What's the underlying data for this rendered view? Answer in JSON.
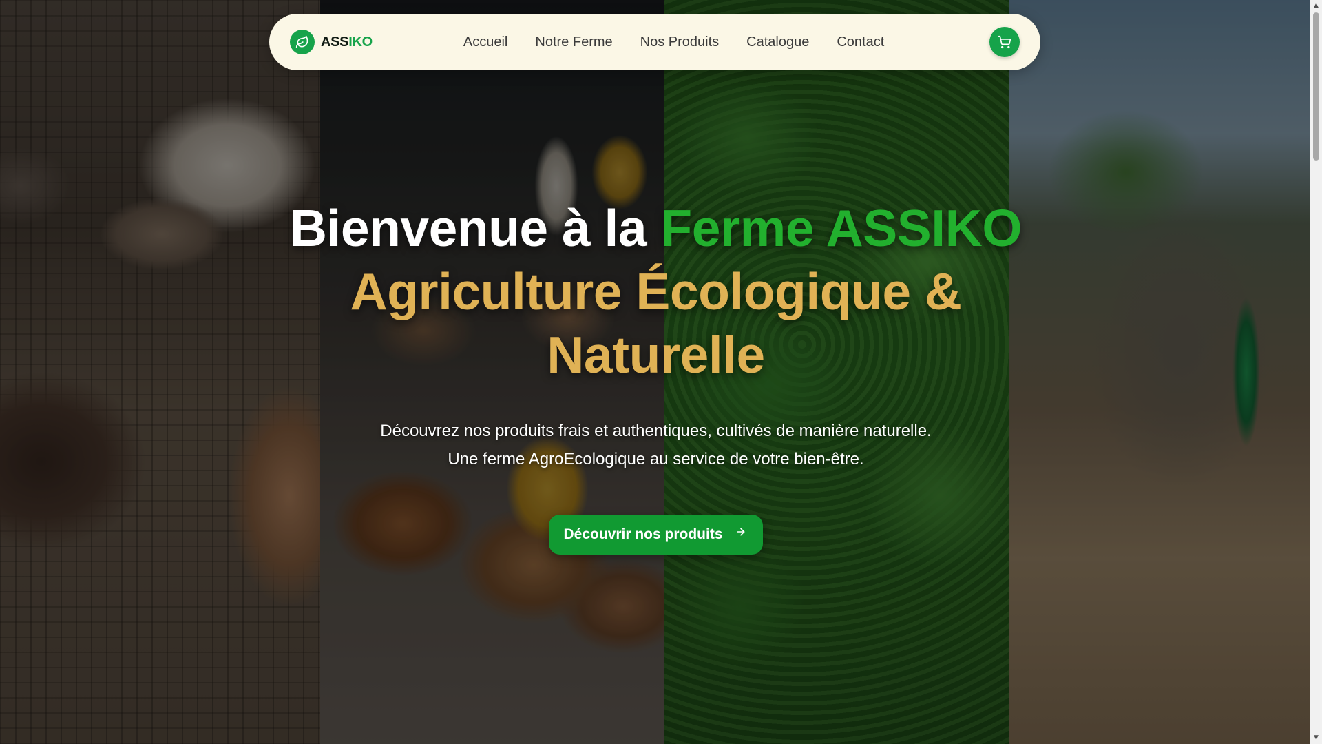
{
  "brand": {
    "name_part1": "ASS",
    "name_part2": "IKO",
    "logo_icon": "leaf-icon",
    "accent_color": "#16a34a"
  },
  "nav": {
    "links": [
      "Accueil",
      "Notre Ferme",
      "Nos Produits",
      "Catalogue",
      "Contact"
    ],
    "cart_icon": "cart-icon"
  },
  "hero": {
    "title_white": "Bienvenue à la ",
    "title_green": "Ferme ASSIKO",
    "title_gold": "Agriculture Écologique & Naturelle",
    "subtitle_line1": "Découvrez nos produits frais et authentiques, cultivés de manière naturelle.",
    "subtitle_line2": "Une ferme AgroEcologique au service de votre bien-être.",
    "cta_label": "Découvrir nos produits",
    "cta_icon": "arrow-right-icon",
    "colors": {
      "green": "#22b02e",
      "gold": "#e0b255",
      "cta": "#119a32"
    },
    "background_images": [
      "rabbits",
      "chickens",
      "green-crops",
      "farm-building"
    ]
  }
}
